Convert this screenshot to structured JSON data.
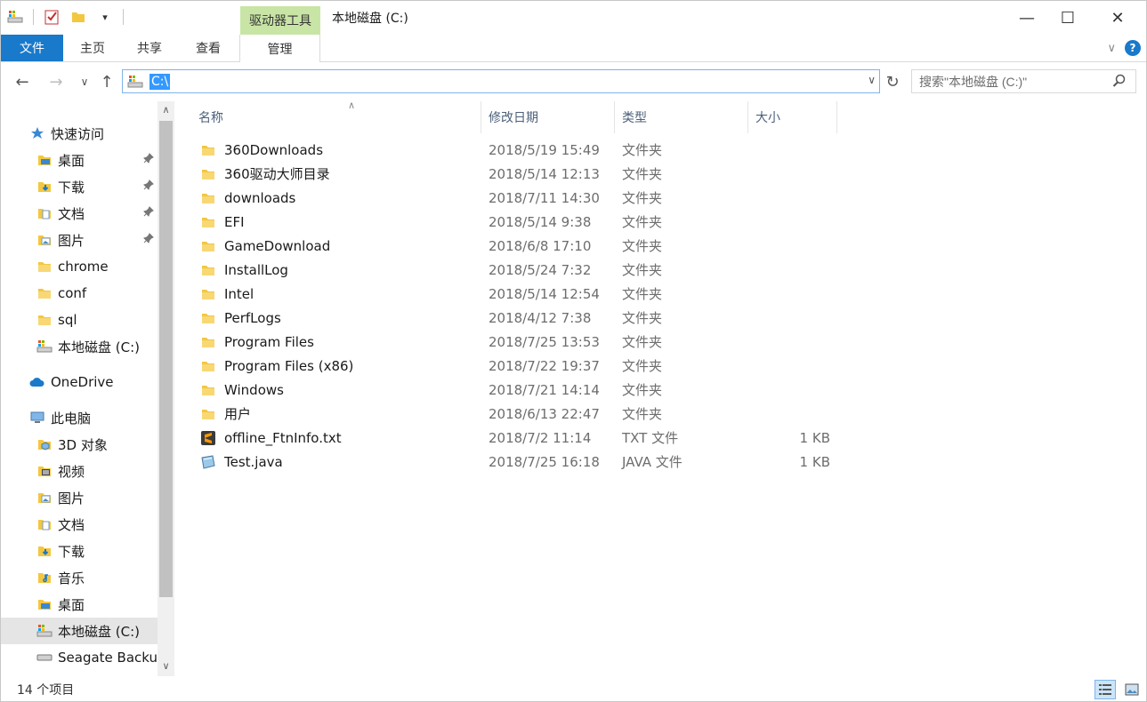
{
  "window": {
    "title": "本地磁盘 (C:)",
    "contextual_tab": "驱动器工具",
    "minimize": "—",
    "maximize": "☐",
    "close": "✕"
  },
  "ribbon": {
    "tabs": [
      "文件",
      "主页",
      "共享",
      "查看",
      "管理"
    ],
    "collapse_icon": "∨",
    "help_icon": "?"
  },
  "nav": {
    "back": "←",
    "forward": "→",
    "recent": "∨",
    "up": "↑",
    "address": "C:\\",
    "dropdown": "∨",
    "refresh": "↻",
    "search_placeholder": "搜索\"本地磁盘 (C:)\""
  },
  "sidebar": {
    "items": [
      {
        "label": "快速访问",
        "icon": "star-icon",
        "level": 0
      },
      {
        "label": "桌面",
        "icon": "desktop-folder-icon",
        "level": 1,
        "pinned": true
      },
      {
        "label": "下载",
        "icon": "download-folder-icon",
        "level": 1,
        "pinned": true
      },
      {
        "label": "文档",
        "icon": "documents-folder-icon",
        "level": 1,
        "pinned": true
      },
      {
        "label": "图片",
        "icon": "pictures-folder-icon",
        "level": 1,
        "pinned": true
      },
      {
        "label": "chrome",
        "icon": "folder-icon",
        "level": 1
      },
      {
        "label": "conf",
        "icon": "folder-icon",
        "level": 1
      },
      {
        "label": "sql",
        "icon": "folder-icon",
        "level": 1
      },
      {
        "label": "本地磁盘 (C:)",
        "icon": "drive-icon",
        "level": 1
      },
      {
        "label": "OneDrive",
        "icon": "cloud-icon",
        "level": 0
      },
      {
        "label": "此电脑",
        "icon": "computer-icon",
        "level": 0
      },
      {
        "label": "3D 对象",
        "icon": "3d-objects-folder-icon",
        "level": 1
      },
      {
        "label": "视频",
        "icon": "videos-folder-icon",
        "level": 1
      },
      {
        "label": "图片",
        "icon": "pictures-folder-icon",
        "level": 1
      },
      {
        "label": "文档",
        "icon": "documents-folder-icon",
        "level": 1
      },
      {
        "label": "下载",
        "icon": "download-folder-icon",
        "level": 1
      },
      {
        "label": "音乐",
        "icon": "music-folder-icon",
        "level": 1
      },
      {
        "label": "桌面",
        "icon": "desktop-folder-icon",
        "level": 1
      },
      {
        "label": "本地磁盘 (C:)",
        "icon": "drive-icon",
        "level": 1,
        "selected": true
      },
      {
        "label": "Seagate Backup",
        "icon": "external-drive-icon",
        "level": 1
      }
    ],
    "scroll_up": "∧",
    "scroll_down": "∨"
  },
  "columns": {
    "name": "名称",
    "date": "修改日期",
    "type": "类型",
    "size": "大小",
    "sort_indicator": "∧"
  },
  "files": [
    {
      "name": "360Downloads",
      "date": "2018/5/19 15:49",
      "type": "文件夹",
      "size": "",
      "icon": "folder-icon"
    },
    {
      "name": "360驱动大师目录",
      "date": "2018/5/14 12:13",
      "type": "文件夹",
      "size": "",
      "icon": "folder-icon"
    },
    {
      "name": "downloads",
      "date": "2018/7/11 14:30",
      "type": "文件夹",
      "size": "",
      "icon": "folder-icon"
    },
    {
      "name": "EFI",
      "date": "2018/5/14 9:38",
      "type": "文件夹",
      "size": "",
      "icon": "folder-icon"
    },
    {
      "name": "GameDownload",
      "date": "2018/6/8 17:10",
      "type": "文件夹",
      "size": "",
      "icon": "folder-icon"
    },
    {
      "name": "InstallLog",
      "date": "2018/5/24 7:32",
      "type": "文件夹",
      "size": "",
      "icon": "folder-icon"
    },
    {
      "name": "Intel",
      "date": "2018/5/14 12:54",
      "type": "文件夹",
      "size": "",
      "icon": "folder-icon"
    },
    {
      "name": "PerfLogs",
      "date": "2018/4/12 7:38",
      "type": "文件夹",
      "size": "",
      "icon": "folder-icon"
    },
    {
      "name": "Program Files",
      "date": "2018/7/25 13:53",
      "type": "文件夹",
      "size": "",
      "icon": "folder-icon"
    },
    {
      "name": "Program Files (x86)",
      "date": "2018/7/22 19:37",
      "type": "文件夹",
      "size": "",
      "icon": "folder-icon"
    },
    {
      "name": "Windows",
      "date": "2018/7/21 14:14",
      "type": "文件夹",
      "size": "",
      "icon": "folder-icon"
    },
    {
      "name": "用户",
      "date": "2018/6/13 22:47",
      "type": "文件夹",
      "size": "",
      "icon": "folder-icon"
    },
    {
      "name": "offline_FtnInfo.txt",
      "date": "2018/7/2 11:14",
      "type": "TXT 文件",
      "size": "1 KB",
      "icon": "sublime-text-icon"
    },
    {
      "name": "Test.java",
      "date": "2018/7/25 16:18",
      "type": "JAVA 文件",
      "size": "1 KB",
      "icon": "java-file-icon"
    }
  ],
  "status": {
    "item_count": "14 个项目"
  },
  "colors": {
    "accent": "#1979ca",
    "contextual_tab_bg": "#c9e5a6",
    "folder": "#f3c73f",
    "selection": "#3399ff"
  }
}
